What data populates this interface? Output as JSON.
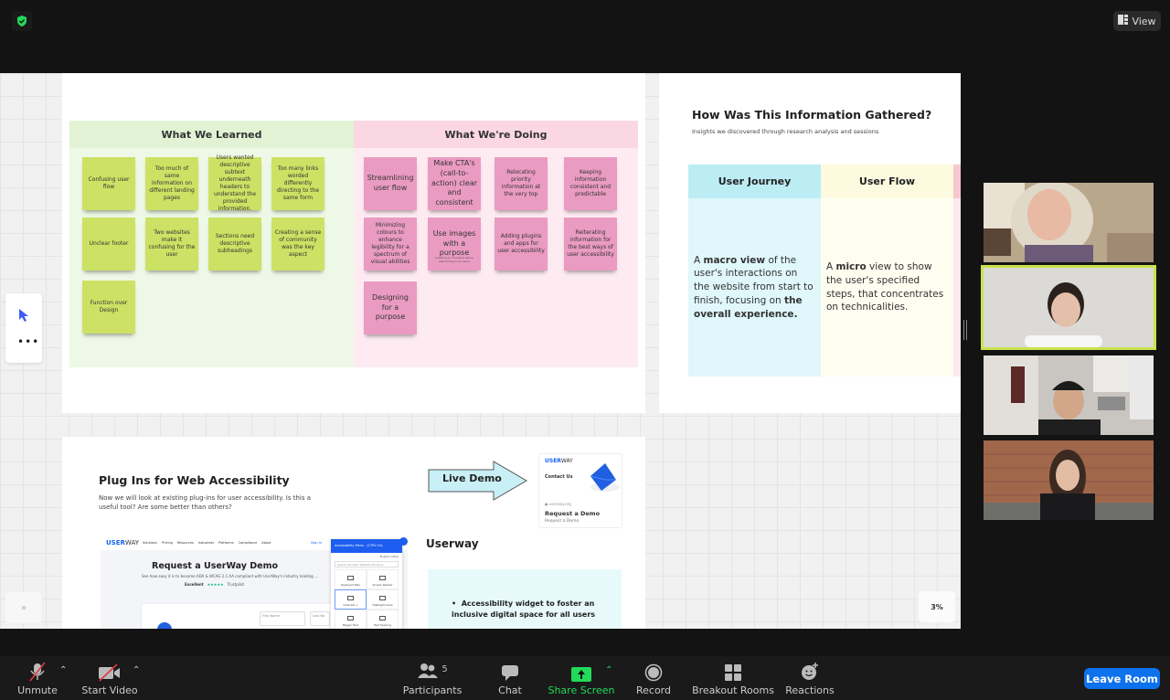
{
  "header": {
    "view_label": "View",
    "security_icon": "shield-check-icon"
  },
  "whiteboard": {
    "learned": {
      "title": "What We Learned",
      "notes": [
        "Confusing user flow",
        "Too much of same information on different landing pages",
        "Users wanted descriptive subtext underneath headers to understand the provided information.",
        "Too many links worded differently directing to the same form",
        "Unclear footer",
        "Two websites make it confusing for the user",
        "Sections need descriptive subheadings",
        "Creating a sense of community was the key aspect",
        "Function over Design"
      ]
    },
    "doing": {
      "title": "What We're Doing",
      "notes": [
        "Streamlining user flow",
        "Make CTA's (call-to-action) clear and consistent",
        "Relocating priority information at the very top",
        "Keeping information consistent and predictable",
        "Minimizing colours to enhance legibility for a spectrum of visual abilities",
        "Use images with a purpose",
        "Adding plugins and apps for user accessibility",
        "Reiterating information for the best ways of user accessibility",
        "Designing for a purpose"
      ],
      "subnote": "Creating an inclusive space welcoming to all users"
    },
    "gathered": {
      "title": "How Was This Information Gathered?",
      "subtitle": "Insights we discovered through research analysis and sessions",
      "columns": [
        {
          "header": "User Journey",
          "pre": "A ",
          "b1": "macro view",
          "mid": " of the user's interactions on the website from start to finish, focusing on ",
          "b2": "the overall experience",
          "post": "."
        },
        {
          "header": "User Flow",
          "pre": "A ",
          "b1": "micro",
          "mid": " view to show the user's specified steps, that concentrates on technicalities.",
          "b2": "",
          "post": ""
        }
      ]
    },
    "plugins": {
      "title": "Plug Ins for Web Accessibility",
      "subtitle": "Now we will look at existing plug-ins for user accessibility. Is this a useful tool? Are some better than others?",
      "live_demo": "Live Demo",
      "demo_card": {
        "brand_a": "USER",
        "brand_b": "WAY",
        "contact": "Contact Us",
        "site": "userway.org",
        "title": "Request a Demo",
        "sub": "Request a Demo"
      },
      "screenshot": {
        "brand_a": "USER",
        "brand_b": "WAY",
        "nav": [
          "Solutions",
          "Pricing",
          "Resources",
          "Industries",
          "Platforms",
          "Compliance",
          "About"
        ],
        "signin": "Sign In",
        "heading": "Request a UserWay Demo",
        "desc": "See how easy it is to become ADA & WCAG 2.1 AA compliant with UserWay's industry leading ...",
        "rating": "Excellent",
        "trustpilot": "Trustpilot",
        "field1": "First Name",
        "field2": "Last Na",
        "menu_title": "Accessibility Menu",
        "menu_shortcut": "(CTRL+U)",
        "menu_lang": "English (USA)",
        "menu_search": "Search Member Website Enhance",
        "menu_items": [
          "Keyboard Nav",
          "Screen Reader",
          "Contrast +",
          "Highlight Links",
          "Bigger Text",
          "Text Spacing"
        ]
      },
      "userway_title": "Userway",
      "userway_bullet": "Accessibility widget to foster an inclusive digital space for all users"
    },
    "zoom_level": "3%",
    "expand_icon": "»"
  },
  "participants_gallery": {
    "tiles": [
      {
        "name": "participant-1",
        "active": false
      },
      {
        "name": "participant-2",
        "active": true
      },
      {
        "name": "participant-3",
        "active": false
      },
      {
        "name": "participant-4",
        "active": false
      }
    ]
  },
  "toolbar": {
    "unmute": "Unmute",
    "start_video": "Start Video",
    "participants": "Participants",
    "participants_count": "5",
    "chat": "Chat",
    "share_screen": "Share Screen",
    "record": "Record",
    "breakout_rooms": "Breakout Rooms",
    "reactions": "Reactions",
    "leave": "Leave Room",
    "share_color": "#23d959",
    "leave_color": "#0e72ed"
  }
}
